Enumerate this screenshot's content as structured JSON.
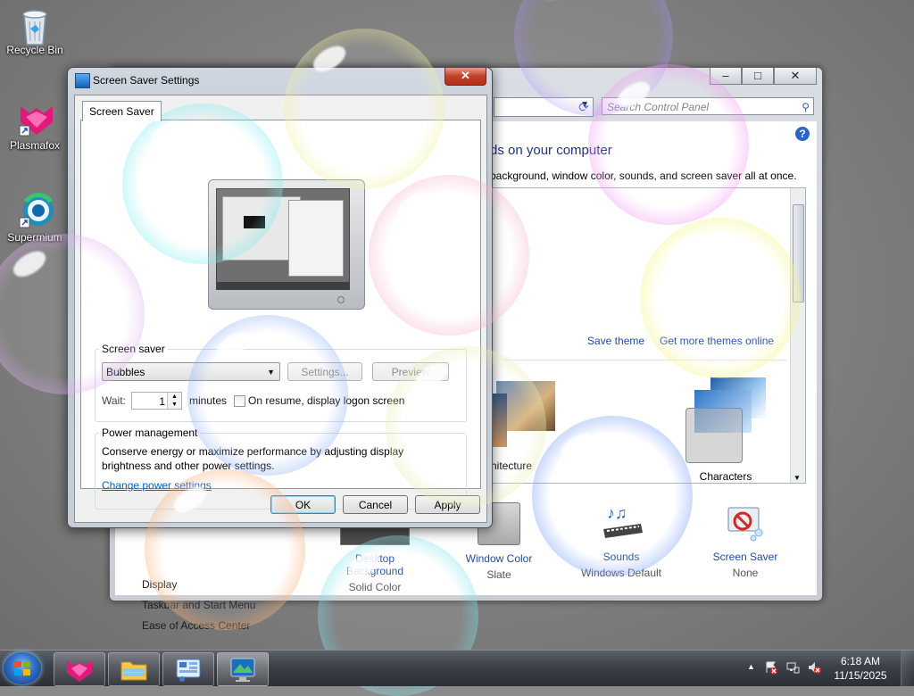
{
  "desktop": {
    "icons": [
      {
        "label": "Recycle Bin"
      },
      {
        "label": "Plasmafox"
      },
      {
        "label": "Supermium"
      }
    ]
  },
  "control_panel": {
    "search_placeholder": "Search Control Panel",
    "heading": "ds on your computer",
    "subheading": "background, window color, sounds, and screen saver all at once.",
    "save_theme": "Save theme",
    "get_more_themes": "Get more themes online",
    "themes": [
      {
        "name": "hitecture"
      },
      {
        "name": "Characters"
      }
    ],
    "left_links": [
      "Display",
      "Taskbar and Start Menu",
      "Ease of Access Center"
    ],
    "bottom_items": [
      {
        "label": "Desktop Background",
        "value": "Solid Color"
      },
      {
        "label": "Window Color",
        "value": "Slate"
      },
      {
        "label": "Sounds",
        "value": "Windows Default"
      },
      {
        "label": "Screen Saver",
        "value": "None"
      }
    ],
    "help_glyph": "?"
  },
  "screen_saver_dialog": {
    "title": "Screen Saver Settings",
    "close_glyph": "✕",
    "tab": "Screen Saver",
    "group_screen_saver": "Screen saver",
    "selected_saver": "Bubbles",
    "settings_button": "Settings...",
    "preview_button": "Preview",
    "wait_label": "Wait:",
    "wait_value": "1",
    "minutes_label": "minutes",
    "resume_label": "On resume, display logon screen",
    "resume_checked": false,
    "group_power": "Power management",
    "power_text": "Conserve energy or maximize performance by adjusting display brightness and other power settings.",
    "power_link": "Change power settings",
    "ok": "OK",
    "cancel": "Cancel",
    "apply": "Apply"
  },
  "taskbar": {
    "time": "6:18 AM",
    "date": "11/15/2025",
    "buttons": [
      "plasmafox-button",
      "file-explorer-button",
      "control-panel-button",
      "screen-saver-settings-button"
    ],
    "tray_up": "▲"
  },
  "colors": {
    "link": "#1e4bb4",
    "heading": "#1e3287",
    "desktop": "#8a8a8a"
  }
}
